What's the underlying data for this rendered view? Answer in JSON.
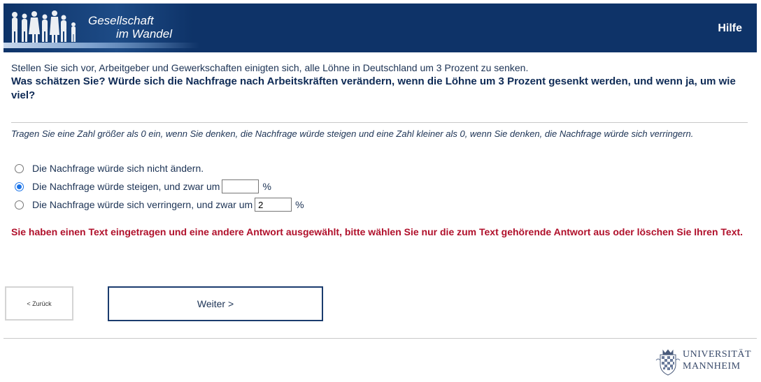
{
  "header": {
    "logo_line1": "Gesellschaft",
    "logo_line2": "im Wandel",
    "help_label": "Hilfe",
    "bg_color": "#0e3368"
  },
  "question": {
    "intro": "Stellen Sie sich vor, Arbeitgeber und Gewerkschaften einigten sich, alle Löhne in Deutschland um 3 Prozent zu senken.",
    "text": "Was schätzen Sie? Würde sich die Nachfrage nach Arbeitskräften verändern, wenn die Löhne um 3 Prozent gesenkt werden, und wenn ja, um wie viel?",
    "hint": "Tragen Sie eine Zahl größer als 0 ein, wenn Sie denken, die Nachfrage würde steigen und eine Zahl kleiner als 0, wenn Sie denken, die Nachfrage würde sich verringern."
  },
  "options": [
    {
      "label": "Die Nachfrage würde sich nicht ändern.",
      "selected": false
    },
    {
      "label": "Die Nachfrage würde steigen, und zwar um",
      "selected": true,
      "value": "",
      "unit": "%"
    },
    {
      "label": "Die Nachfrage würde sich verringern, und zwar um",
      "selected": false,
      "value": "2",
      "unit": "%"
    }
  ],
  "error": {
    "text": "Sie haben einen Text eingetragen und eine andere Antwort ausgewählt, bitte wählen Sie nur die zum Text gehörende Antwort aus oder löschen Sie Ihren Text.",
    "color": "#b0102b"
  },
  "nav": {
    "back_label": "< Zurück",
    "next_label": "Weiter >"
  },
  "footer": {
    "uni_line1": "UNIVERSITÄT",
    "uni_line2": "MANNHEIM"
  }
}
